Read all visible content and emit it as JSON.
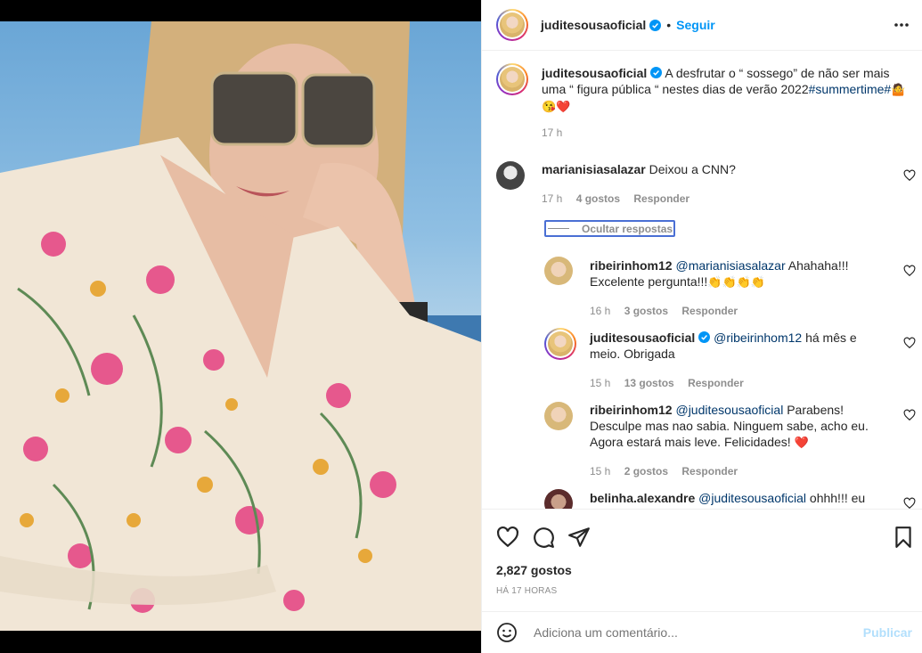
{
  "post": {
    "author": "juditesousaoficial",
    "follow_label": "Seguir",
    "dot": "•"
  },
  "caption": {
    "username": "juditesousaoficial",
    "text": "A desfrutar o “ sossego” de não ser mais uma “ figura pública “ nestes dias de verão 2022",
    "hashtag": "#summertime#",
    "emojis": "🤷😘❤️",
    "time": "17 h"
  },
  "comments": [
    {
      "username": "marianisiasalazar",
      "text": "Deixou a CNN?",
      "time": "17 h",
      "likes": "4 gostos",
      "reply": "Responder"
    }
  ],
  "hide_replies_label": "Ocultar respostas",
  "replies": [
    {
      "username": "ribeirinhom12",
      "mention": "@marianisiasalazar",
      "text": " Ahahaha!!! Excelente pergunta!!!",
      "emojis": "👏👏👏👏",
      "time": "16 h",
      "likes": "3 gostos",
      "reply": "Responder"
    },
    {
      "username": "juditesousaoficial",
      "mention": "@ribeirinhom12",
      "text": " há mês e meio. Obrigada",
      "time": "15 h",
      "likes": "13 gostos",
      "reply": "Responder"
    },
    {
      "username": "ribeirinhom12",
      "mention": "@juditesousaoficial",
      "text": " Parabens! Desculpe mas nao sabia. Ninguem sabe, acho eu. Agora estará mais leve. Felicidades! ",
      "emojis": "❤️",
      "time": "15 h",
      "likes": "2 gostos",
      "reply": "Responder"
    },
    {
      "username": "belinha.alexandre",
      "mention": "@juditesousaoficial",
      "text": " ohhh!!! eu"
    }
  ],
  "footer": {
    "likes": "2,827 gostos",
    "time_ago": "HÁ 17 HORAS",
    "comment_placeholder": "Adiciona um comentário...",
    "publish_label": "Publicar"
  },
  "icons": {
    "verified": "verified-badge-icon",
    "more": "more-options-icon",
    "like": "heart-icon",
    "comment": "comment-icon",
    "share": "share-icon",
    "save": "bookmark-icon",
    "emoji": "emoji-icon"
  },
  "colors": {
    "accent": "#0095f6",
    "link": "#00376b",
    "muted": "#8e8e8e",
    "publish_disabled": "#b2dffc"
  }
}
